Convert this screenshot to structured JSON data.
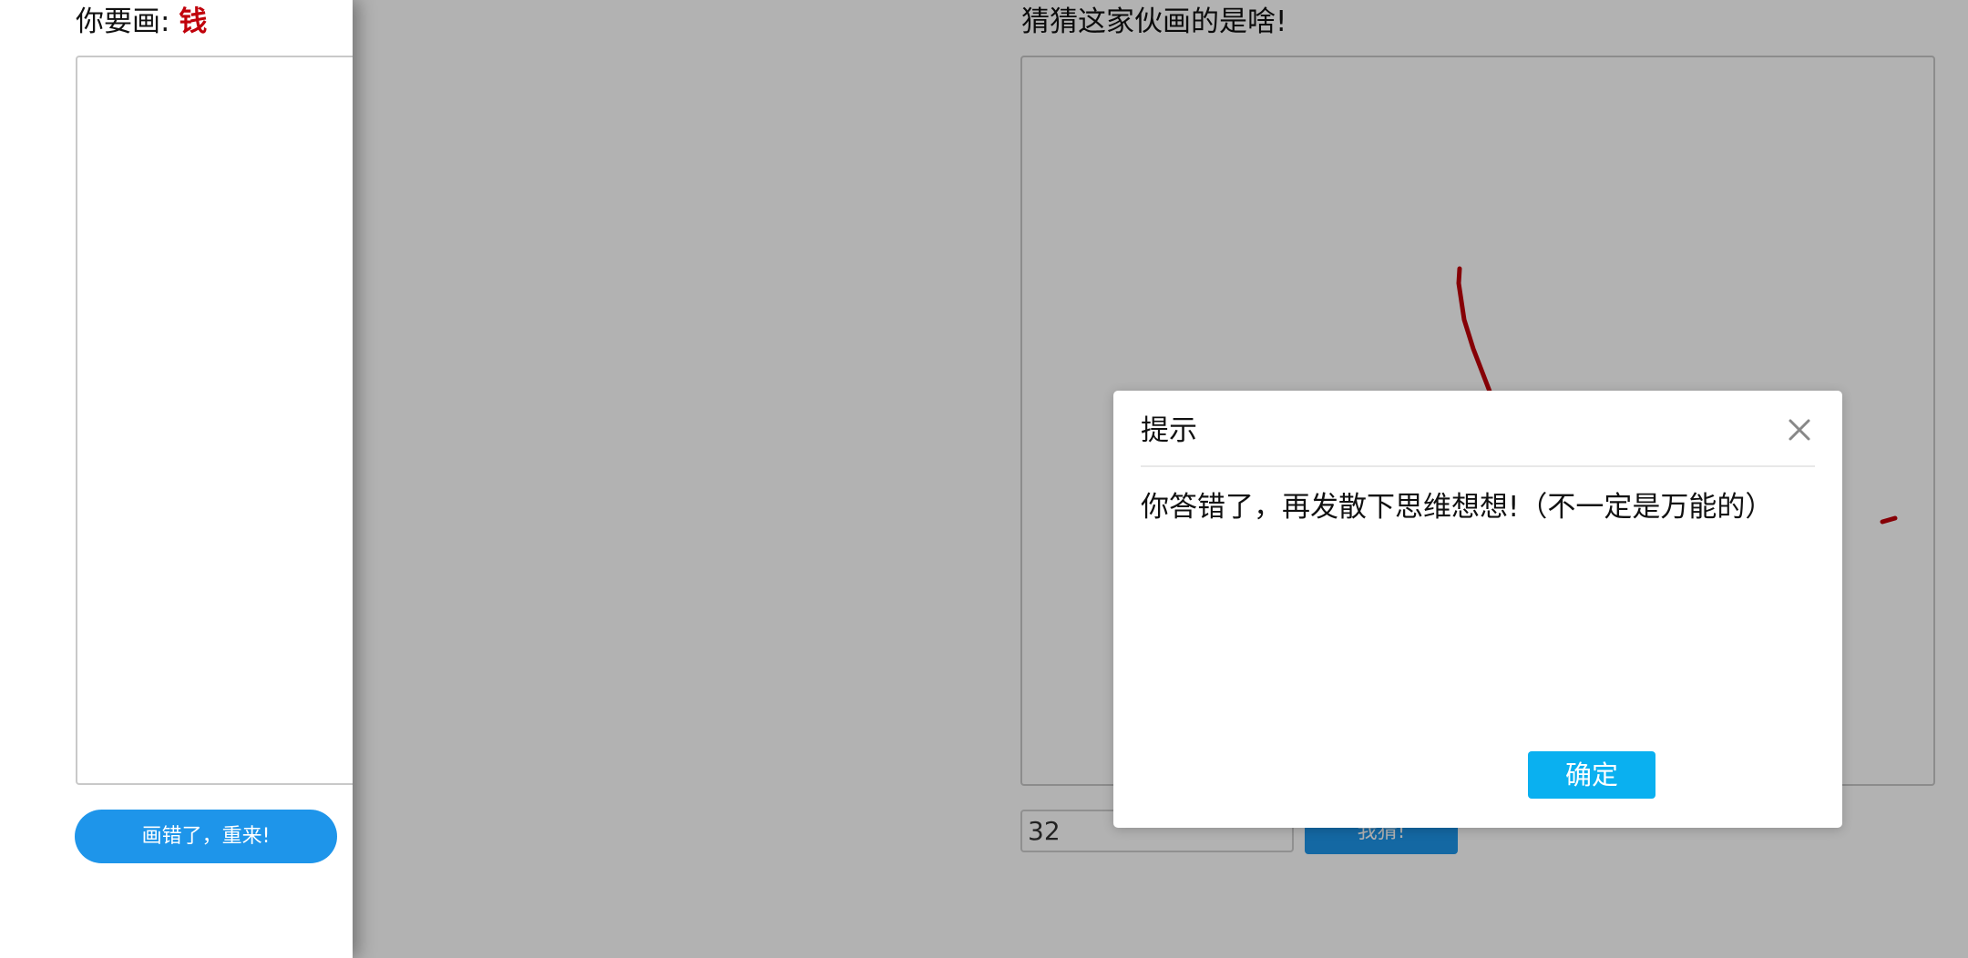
{
  "left_panel": {
    "prompt_prefix": "你要画:",
    "prompt_word": "钱",
    "redraw_label": "画错了，重来!"
  },
  "right_panel": {
    "title": "猜猜这家伙画的是啥!",
    "guess_value": "32",
    "guess_button_label": "我猜!"
  },
  "dialog": {
    "title": "提示",
    "message": "你答错了，再发散下思维想想!（不一定是万能的）",
    "confirm_label": "确定",
    "close_icon": "close-icon"
  },
  "colors": {
    "accent": "#1e95ea",
    "confirm": "#0ab0f0",
    "highlight_word": "#c0000a",
    "stroke": "#c0000a"
  }
}
